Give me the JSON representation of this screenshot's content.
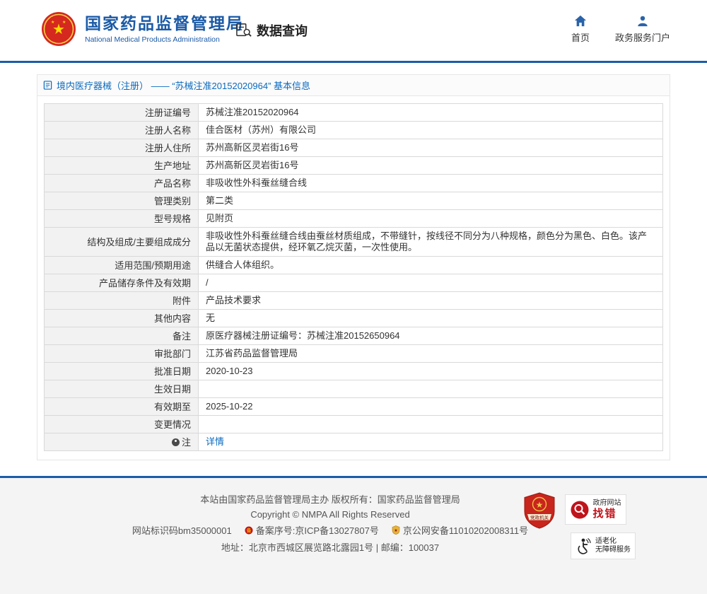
{
  "header": {
    "logo_title": "国家药品监督管理局",
    "logo_subtitle": "National Medical Products Administration",
    "data_query": "数据查询",
    "nav": [
      {
        "label": "首页"
      },
      {
        "label": "政务服务门户"
      }
    ]
  },
  "breadcrumb": "境内医疗器械（注册） —— “苏械注准20152020964” 基本信息",
  "table": {
    "rows": [
      {
        "label": "注册证编号",
        "value": "苏械注准20152020964"
      },
      {
        "label": "注册人名称",
        "value": "佳合医材（苏州）有限公司"
      },
      {
        "label": "注册人住所",
        "value": "苏州高新区灵岩街16号"
      },
      {
        "label": "生产地址",
        "value": "苏州高新区灵岩街16号"
      },
      {
        "label": "产品名称",
        "value": "非吸收性外科蚕丝缝合线"
      },
      {
        "label": "管理类别",
        "value": "第二类"
      },
      {
        "label": "型号规格",
        "value": "见附页"
      },
      {
        "label": "结构及组成/主要组成成分",
        "value": "非吸收性外科蚕丝缝合线由蚕丝材质组成，不带缝针，按线径不同分为八种规格，颜色分为黑色、白色。该产品以无菌状态提供，经环氧乙烷灭菌，一次性使用。"
      },
      {
        "label": "适用范围/预期用途",
        "value": "供缝合人体组织。"
      },
      {
        "label": "产品储存条件及有效期",
        "value": "/"
      },
      {
        "label": "附件",
        "value": "产品技术要求"
      },
      {
        "label": "其他内容",
        "value": "无"
      },
      {
        "label": "备注",
        "value": "原医疗器械注册证编号：苏械注准20152650964"
      },
      {
        "label": "审批部门",
        "value": "江苏省药品监督管理局"
      },
      {
        "label": "批准日期",
        "value": "2020-10-23"
      },
      {
        "label": "生效日期",
        "value": ""
      },
      {
        "label": "有效期至",
        "value": "2025-10-22"
      },
      {
        "label": "变更情况",
        "value": ""
      },
      {
        "label": "注",
        "icon": "note",
        "link": "详情"
      }
    ]
  },
  "footer": {
    "line1": "本站由国家药品监督管理局主办 版权所有：国家药品监督管理局",
    "line2": "Copyright © NMPA All Rights Reserved",
    "site_code": "网站标识码bm35000001",
    "icp": "备案序号:京ICP备13027807号",
    "police": "京公网安备11010202008311号",
    "address": "地址：北京市西城区展览路北露园1号 | 邮编：100037",
    "badge_gov": "党政机关",
    "badge_error_top": "政府网站",
    "badge_error_main": "找错",
    "badge_access_line1": "适老化",
    "badge_access_line2": "无障碍服务"
  }
}
